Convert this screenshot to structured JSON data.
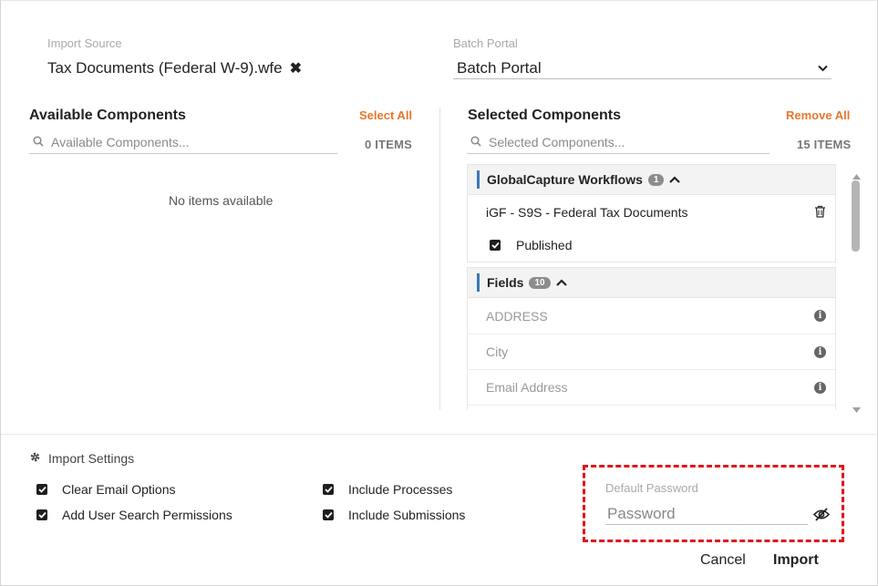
{
  "import_source": {
    "label": "Import Source",
    "value": "Tax Documents (Federal W-9).wfe"
  },
  "batch_portal": {
    "label": "Batch Portal",
    "value": "Batch Portal"
  },
  "available": {
    "title": "Available Components",
    "select_all": "Select All",
    "search_placeholder": "Available Components...",
    "count": "0 ITEMS",
    "empty_text": "No items available"
  },
  "selected": {
    "title": "Selected Components",
    "remove_all": "Remove All",
    "search_placeholder": "Selected Components...",
    "count": "15 ITEMS",
    "groups": [
      {
        "name": "GlobalCapture Workflows",
        "count": "1",
        "item": "iGF - S9S - Federal Tax Documents",
        "checkbox_label": "Published"
      },
      {
        "name": "Fields",
        "count": "10",
        "items": [
          "ADDRESS",
          "City",
          "Email Address"
        ]
      }
    ]
  },
  "settings": {
    "title": "Import Settings",
    "options": [
      "Clear Email Options",
      "Add User Search Permissions",
      "Include Processes",
      "Include Submissions"
    ]
  },
  "password": {
    "label": "Default Password",
    "placeholder": "Password"
  },
  "buttons": {
    "cancel": "Cancel",
    "import": "Import"
  },
  "colors": {
    "accent_orange": "#e8762c",
    "group_bar_blue": "#3a79b8",
    "highlight_red": "#e0171b"
  },
  "icons": [
    "close-icon",
    "chevron-down-icon",
    "search-icon",
    "chevron-up-icon",
    "trash-icon",
    "info-icon",
    "gear-icon",
    "eye-slash-icon",
    "checkbox-checked-icon"
  ]
}
